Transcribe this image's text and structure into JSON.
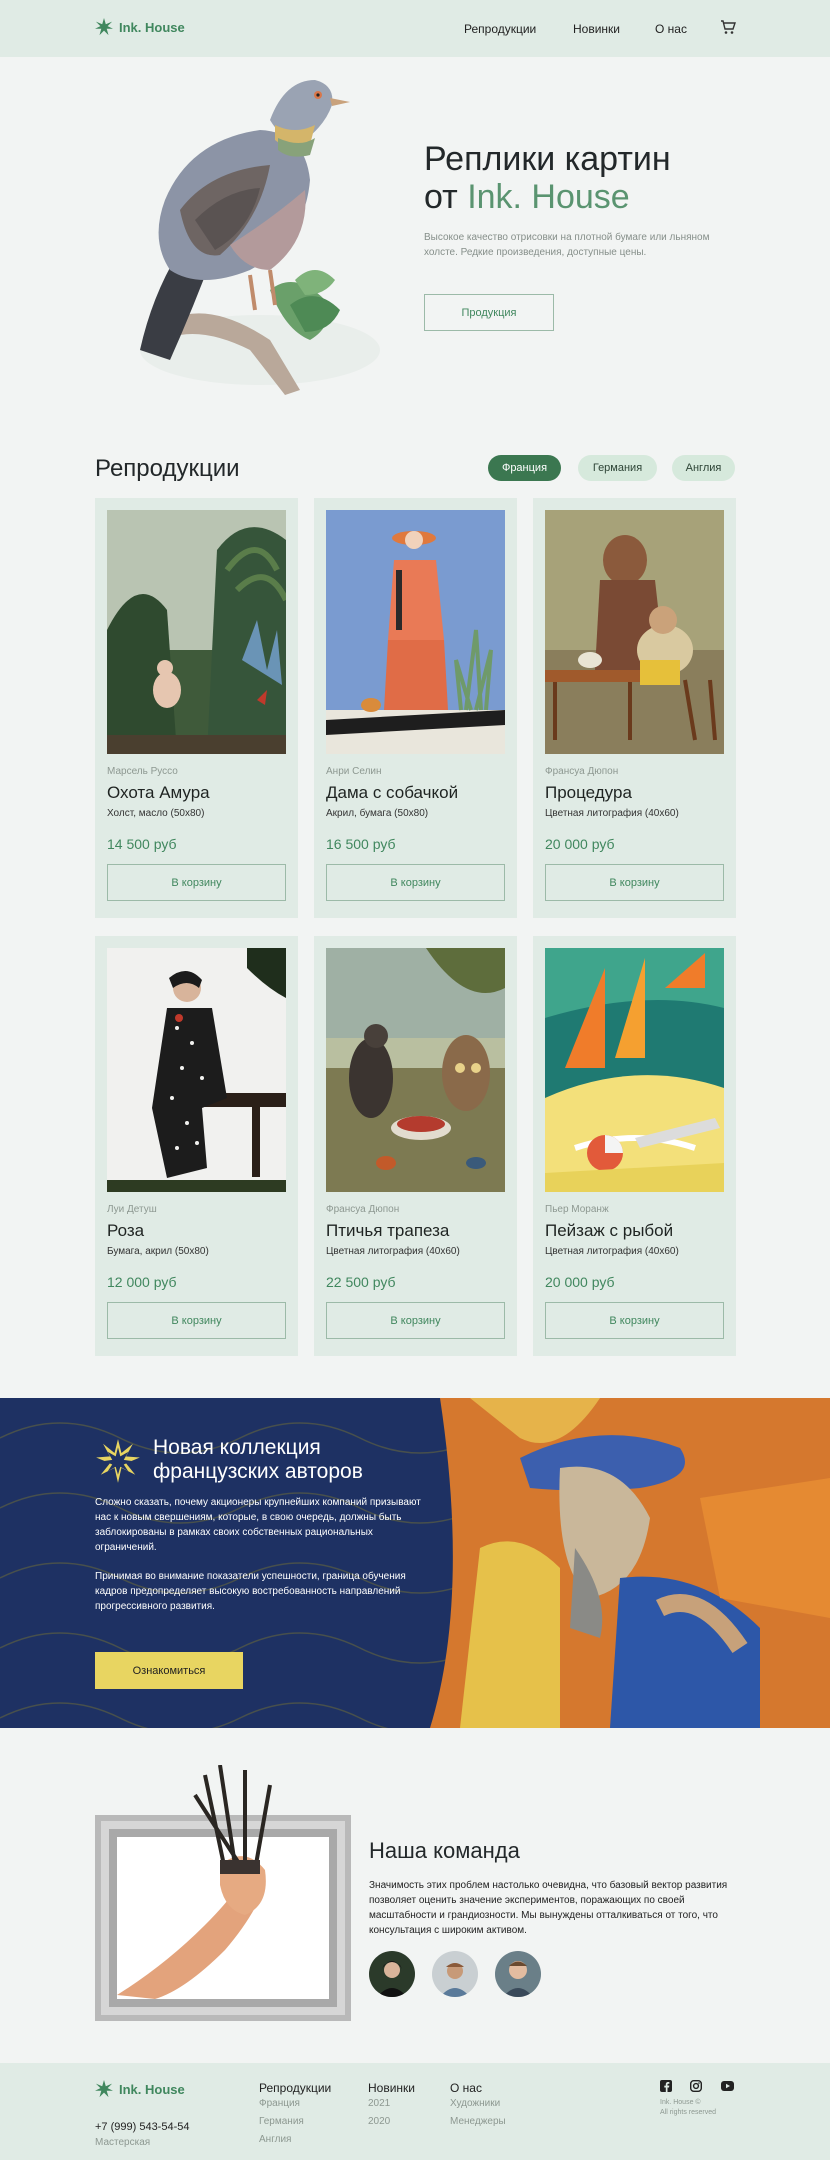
{
  "brand": {
    "name": "Ink. House",
    "accent": "#40875e"
  },
  "nav": {
    "items": [
      "Репродукции",
      "Новинки",
      "О нас"
    ]
  },
  "hero": {
    "title_line1": "Реплики картин",
    "title_prefix": "от ",
    "title_accent": "Ink. House",
    "subtitle": "Высокое качество отрисовки на плотной бумаге или льняном холсте. Редкие произведения, доступные цены.",
    "button": "Продукция"
  },
  "products": {
    "title": "Репродукции",
    "filters": [
      {
        "label": "Франция",
        "active": true
      },
      {
        "label": "Германия",
        "active": false
      },
      {
        "label": "Англия",
        "active": false
      }
    ],
    "items": [
      {
        "author": "Марсель Руссо",
        "title": "Охота Амура",
        "meta": "Холст, масло (50x80)",
        "price": "14 500 руб",
        "button": "В корзину"
      },
      {
        "author": "Анри Селин",
        "title": "Дама с собачкой",
        "meta": "Акрил, бумага (50x80)",
        "price": "16 500 руб",
        "button": "В корзину"
      },
      {
        "author": "Франсуа Дюпон",
        "title": "Процедура",
        "meta": "Цветная литография (40x60)",
        "price": "20 000 руб",
        "button": "В корзину"
      },
      {
        "author": "Луи Детуш",
        "title": "Роза",
        "meta": "Бумага, акрил (50x80)",
        "price": "12 000 руб",
        "button": "В корзину"
      },
      {
        "author": "Франсуа Дюпон",
        "title": "Птичья трапеза",
        "meta": "Цветная литография (40x60)",
        "price": "22 500 руб",
        "button": "В корзину"
      },
      {
        "author": "Пьер Моранж",
        "title": "Пейзаж с рыбой",
        "meta": "Цветная литография (40x60)",
        "price": "20 000 руб",
        "button": "В корзину"
      }
    ]
  },
  "banner": {
    "title": "Новая коллекция французских авторов",
    "p1": "Сложно сказать, почему акционеры крупнейших компаний призывают нас к новым свершениям, которые, в свою очередь, должны быть заблокированы в рамках своих собственных рациональных ограничений.",
    "p2": "Принимая во внимание показатели успешности, граница обучения кадров предопределяет высокую востребованность направлений прогрессивного развития.",
    "button": "Ознакомиться"
  },
  "team": {
    "title": "Наша команда",
    "text": "Значимость этих проблем настолько очевидна, что базовый вектор развития позволяет оценить значение экспериментов, поражающих по своей масштабности и грандиозности. Мы вынуждены отталкиваться от того, что консультация с широким активом."
  },
  "footer": {
    "col1": {
      "title": "Репродукции",
      "links": [
        "Франция",
        "Германия",
        "Англия"
      ]
    },
    "col2": {
      "title": "Новинки",
      "links": [
        "2021",
        "2020"
      ]
    },
    "col3": {
      "title": "О нас",
      "links": [
        "Художники",
        "Менеджеры"
      ]
    },
    "phone": "+7 (999) 543-54-54",
    "address": "Мастерская",
    "copyright": "Ink. House ©",
    "rights": "All rights reserved"
  }
}
